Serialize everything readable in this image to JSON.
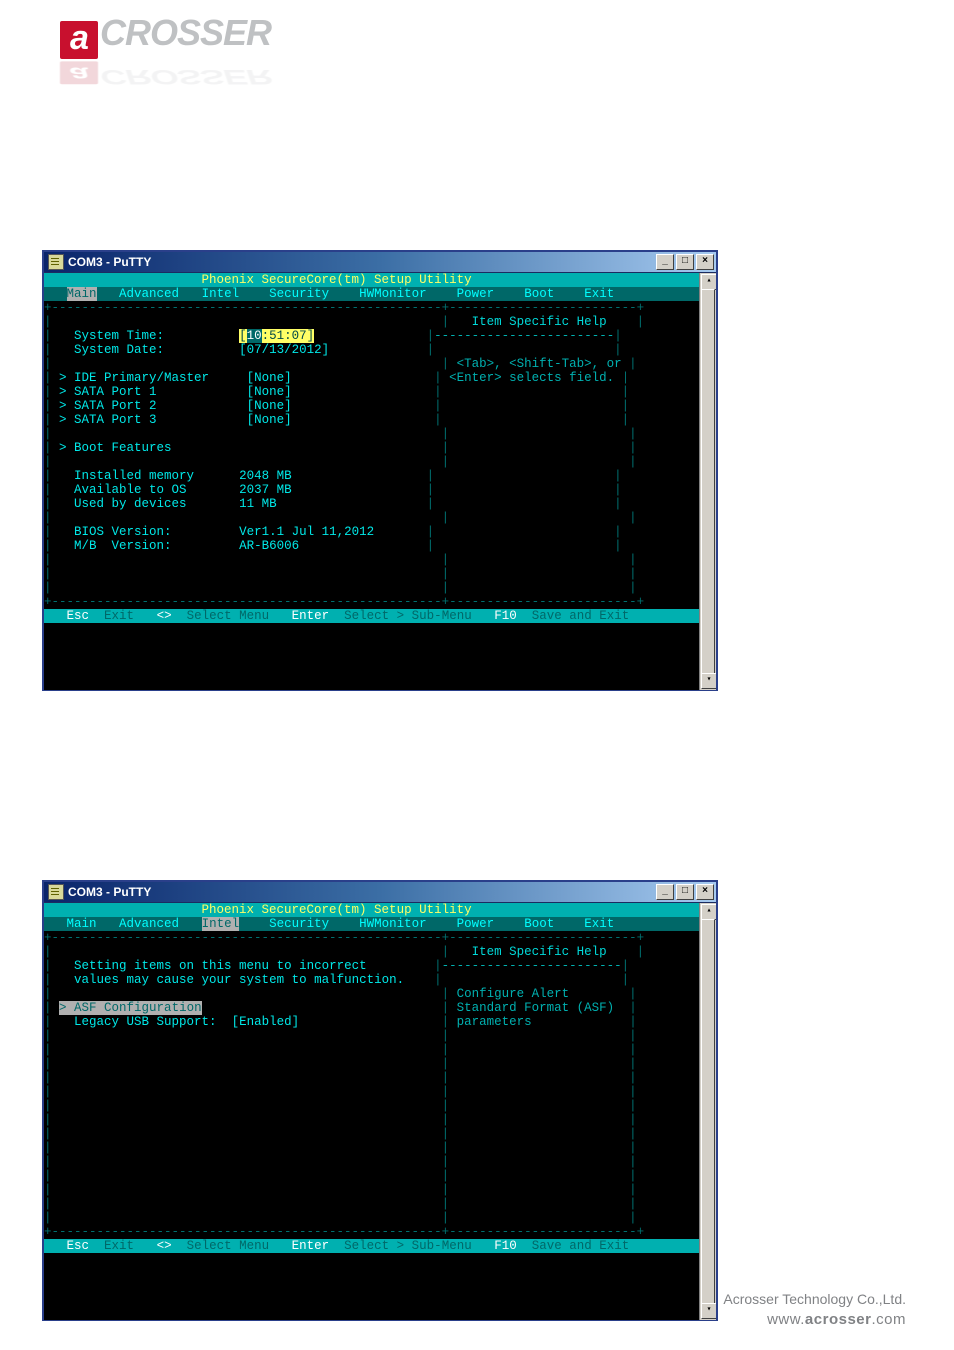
{
  "logo": {
    "text": "CROSSER"
  },
  "footer": {
    "company": "Acrosser Technology Co.,Ltd.",
    "url": "www.acrosser.com"
  },
  "windows": [
    {
      "title": "COM3 - PuTTY",
      "bios": {
        "header": "Phoenix SecureCore(tm) Setup Utility",
        "tabs": [
          "Main",
          "Advanced",
          "Intel",
          "Security",
          "HWMonitor",
          "Power",
          "Boot",
          "Exit"
        ],
        "active_tab_index": 0,
        "help_title": "Item Specific Help",
        "help_lines": [
          "<Tab>, <Shift-Tab>, or",
          "<Enter> selects field."
        ],
        "fields": [
          {
            "label": "System Time:",
            "value_prefix": "[",
            "hour": "10",
            "rest": ":51:07",
            "value_suffix": "]",
            "editable": true
          },
          {
            "label": "System Date:",
            "value": "[07/13/2012]",
            "editable": true
          }
        ],
        "submenus": [
          {
            "label": "IDE Primary/Master",
            "value": "[None]"
          },
          {
            "label": "SATA Port 1",
            "value": "[None]"
          },
          {
            "label": "SATA Port 2",
            "value": "[None]"
          },
          {
            "label": "SATA Port 3",
            "value": "[None]"
          }
        ],
        "boot_features_label": "Boot Features",
        "memory": [
          {
            "label": "Installed memory",
            "value": "2048 MB"
          },
          {
            "label": "Available to OS",
            "value": "2037 MB"
          },
          {
            "label": "Used by devices",
            "value": "11 MB"
          }
        ],
        "versions": [
          {
            "label": "BIOS Version:",
            "value": "Ver1.1 Jul 11,2012"
          },
          {
            "label": "M/B  Version:",
            "value": "AR-B6006"
          }
        ],
        "footer_keys": [
          {
            "key": "Esc",
            "label": "Exit"
          },
          {
            "key": "<>",
            "label": "Select Menu"
          },
          {
            "key": "Enter",
            "label": "Select > Sub-Menu"
          },
          {
            "key": "F10",
            "label": "Save and Exit"
          }
        ]
      }
    },
    {
      "title": "COM3 - PuTTY",
      "bios": {
        "header": "Phoenix SecureCore(tm) Setup Utility",
        "tabs": [
          "Main",
          "Advanced",
          "Intel",
          "Security",
          "HWMonitor",
          "Power",
          "Boot",
          "Exit"
        ],
        "active_tab_index": 2,
        "help_title": "Item Specific Help",
        "help_lines": [
          "Configure Alert",
          "Standard Format (ASF)",
          "parameters"
        ],
        "warning": [
          "Setting items on this menu to incorrect",
          "values may cause your system to malfunction."
        ],
        "items": [
          {
            "label": "ASF Configuration",
            "type": "submenu",
            "selected": true
          },
          {
            "label": "Legacy USB Support:",
            "value": "[Enabled]",
            "type": "field"
          }
        ],
        "footer_keys": [
          {
            "key": "Esc",
            "label": "Exit"
          },
          {
            "key": "<>",
            "label": "Select Menu"
          },
          {
            "key": "Enter",
            "label": "Select > Sub-Menu"
          },
          {
            "key": "F10",
            "label": "Save and Exit"
          }
        ]
      }
    }
  ]
}
